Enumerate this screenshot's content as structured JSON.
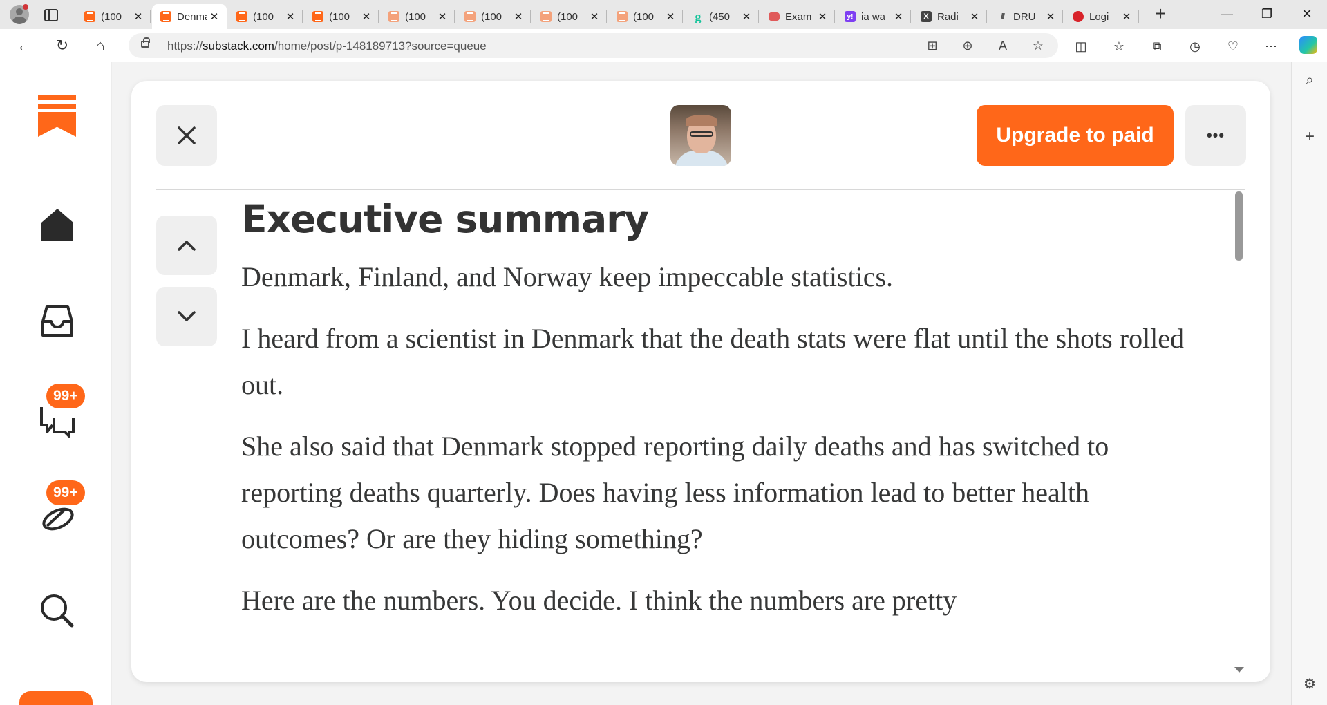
{
  "browser": {
    "tabs": [
      {
        "title": "(100",
        "icon": "substack-icon",
        "active": false
      },
      {
        "title": "Denmark",
        "icon": "substack-icon",
        "active": true
      },
      {
        "title": "(100",
        "icon": "substack-icon",
        "active": false
      },
      {
        "title": "(100",
        "icon": "substack-icon",
        "active": false
      },
      {
        "title": "(100",
        "icon": "substack-icon",
        "active": false
      },
      {
        "title": "(100",
        "icon": "substack-icon",
        "active": false
      },
      {
        "title": "(100",
        "icon": "substack-icon",
        "active": false
      },
      {
        "title": "(100",
        "icon": "substack-icon",
        "active": false
      },
      {
        "title": "(450",
        "icon": "grammarly-icon",
        "active": false
      },
      {
        "title": "Exam",
        "icon": "youtube-icon",
        "active": false
      },
      {
        "title": "ia wa",
        "icon": "yahoo-icon",
        "active": false
      },
      {
        "title": "Radi",
        "icon": "x-icon",
        "active": false
      },
      {
        "title": "DRU",
        "icon": "drudge-icon",
        "active": false
      },
      {
        "title": "Logi",
        "icon": "red-icon",
        "active": false
      }
    ],
    "address": {
      "prefix": "https://",
      "domain": "substack.com",
      "path": "/home/post/p-148189713?source=queue"
    }
  },
  "sidebar": {
    "chat_badge": "99+",
    "activity_badge": "99+"
  },
  "reader": {
    "upgrade_label": "Upgrade to paid",
    "more_label": "•••"
  },
  "article": {
    "heading": "Executive summary",
    "paragraphs": [
      "Denmark, Finland, and Norway keep impeccable statistics.",
      "I heard from a scientist in Denmark that the death stats were flat until the shots rolled out.",
      "She also said that Denmark stopped reporting daily deaths and has switched to reporting deaths quarterly. Does having less information lead to better health outcomes? Or are they hiding something?",
      "Here are the numbers. You decide. I think the numbers are pretty"
    ]
  },
  "colors": {
    "accent": "#ff6719",
    "text": "#363737",
    "button_bg": "#efefef"
  }
}
